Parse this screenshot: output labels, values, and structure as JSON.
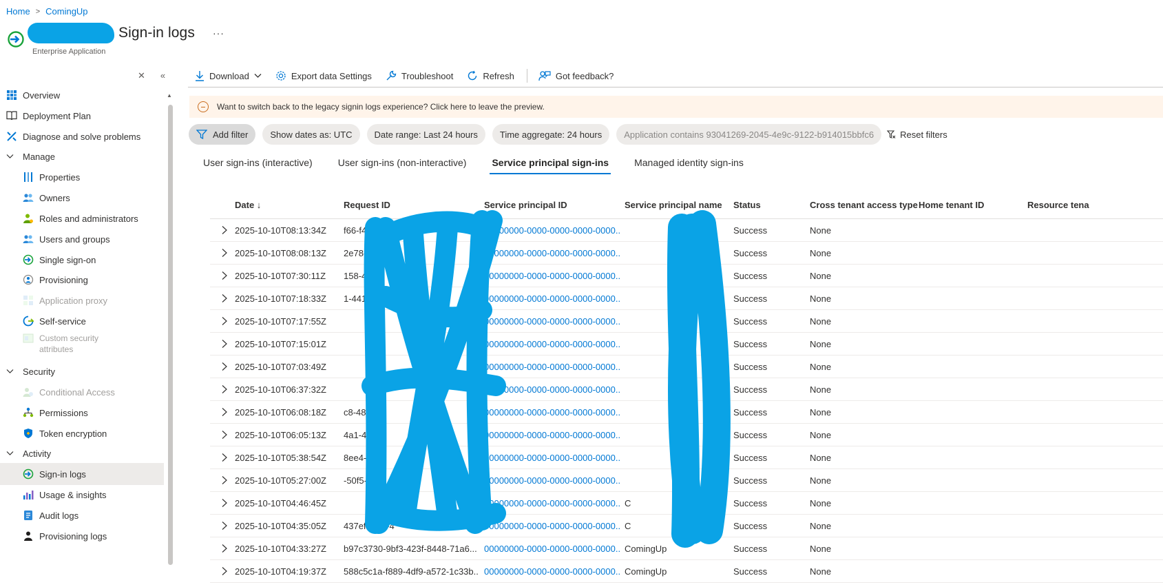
{
  "breadcrumb": [
    {
      "label": "Home"
    },
    {
      "label": "ComingUp"
    }
  ],
  "header": {
    "title": "Sign-in logs",
    "subtitle": "Enterprise Application",
    "more": "···"
  },
  "sidebar": {
    "items": [
      {
        "label": "Overview",
        "icon": "overview-icon",
        "level": 0,
        "type": "item"
      },
      {
        "label": "Deployment Plan",
        "icon": "book-icon",
        "level": 0,
        "type": "item"
      },
      {
        "label": "Diagnose and solve problems",
        "icon": "wrench-icon",
        "level": 0,
        "type": "item"
      },
      {
        "label": "Manage",
        "level": 0,
        "type": "group"
      },
      {
        "label": "Properties",
        "icon": "properties-icon",
        "level": 1,
        "type": "item"
      },
      {
        "label": "Owners",
        "icon": "owners-icon",
        "level": 1,
        "type": "item"
      },
      {
        "label": "Roles and administrators",
        "icon": "roles-icon",
        "level": 1,
        "type": "item"
      },
      {
        "label": "Users and groups",
        "icon": "users-icon",
        "level": 1,
        "type": "item"
      },
      {
        "label": "Single sign-on",
        "icon": "sso-icon",
        "level": 1,
        "type": "item"
      },
      {
        "label": "Provisioning",
        "icon": "provisioning-icon",
        "level": 1,
        "type": "item"
      },
      {
        "label": "Application proxy",
        "icon": "proxy-icon",
        "level": 1,
        "type": "item",
        "disabled": true
      },
      {
        "label": "Self-service",
        "icon": "self-service-icon",
        "level": 1,
        "type": "item"
      },
      {
        "label": "Custom security attributes",
        "icon": "custom-attributes-icon",
        "level": 1,
        "type": "item",
        "disabled": true,
        "twoline": true
      },
      {
        "label": "Security",
        "level": 0,
        "type": "group"
      },
      {
        "label": "Conditional Access",
        "icon": "conditional-access-icon",
        "level": 1,
        "type": "item",
        "disabled": true
      },
      {
        "label": "Permissions",
        "icon": "permissions-icon",
        "level": 1,
        "type": "item"
      },
      {
        "label": "Token encryption",
        "icon": "shield-icon",
        "level": 1,
        "type": "item"
      },
      {
        "label": "Activity",
        "level": 0,
        "type": "group"
      },
      {
        "label": "Sign-in logs",
        "icon": "sign-in-icon",
        "level": 1,
        "type": "item",
        "active": true
      },
      {
        "label": "Usage & insights",
        "icon": "insights-icon",
        "level": 1,
        "type": "item"
      },
      {
        "label": "Audit logs",
        "icon": "audit-icon",
        "level": 1,
        "type": "item"
      },
      {
        "label": "Provisioning logs",
        "icon": "person-icon",
        "level": 1,
        "type": "item"
      }
    ]
  },
  "toolbar": {
    "download": "Download",
    "export": "Export data Settings",
    "troubleshoot": "Troubleshoot",
    "refresh": "Refresh",
    "feedback": "Got feedback?"
  },
  "banner": {
    "text": "Want to switch back to the legacy signin logs experience? Click here to leave the preview."
  },
  "filters": {
    "add": "Add filter",
    "dates": "Show dates as: UTC",
    "range": "Date range: Last 24 hours",
    "aggregate": "Time aggregate: 24 hours",
    "application": "Application contains 93041269-2045-4e9c-9122-b914015bbfc6",
    "reset": "Reset filters"
  },
  "tabs": [
    {
      "label": "User sign-ins (interactive)"
    },
    {
      "label": "User sign-ins (non-interactive)"
    },
    {
      "label": "Service principal sign-ins",
      "active": true
    },
    {
      "label": "Managed identity sign-ins"
    }
  ],
  "table": {
    "columns": {
      "date": "Date ↓",
      "request_id": "Request ID",
      "sp_id": "Service principal ID",
      "sp_name": "Service principal name",
      "status": "Status",
      "cross_tenant": "Cross tenant access type",
      "home_tenant": "Home tenant ID",
      "resource_tenant": "Resource tena"
    },
    "rows": [
      {
        "date": "2025-10-10T08:13:34Z",
        "request_id": "f66-f450-4771-9250",
        "sp_id": "00000000-0000-0000-0000-0000...",
        "sp_name": "",
        "status": "Success",
        "cross_tenant": "None"
      },
      {
        "date": "2025-10-10T08:08:13Z",
        "request_id": "2e78-4c0",
        "sp_id": "00000000-0000-0000-0000-0000...",
        "sp_name": "",
        "status": "Success",
        "cross_tenant": "None"
      },
      {
        "date": "2025-10-10T07:30:11Z",
        "request_id": "158-4335",
        "sp_id": "00000000-0000-0000-0000-0000...",
        "sp_name": "",
        "status": "Success",
        "cross_tenant": "None"
      },
      {
        "date": "2025-10-10T07:18:33Z",
        "request_id": "1-441",
        "sp_id": "00000000-0000-0000-0000-0000...",
        "sp_name": "",
        "status": "Success",
        "cross_tenant": "None"
      },
      {
        "date": "2025-10-10T07:17:55Z",
        "request_id": "",
        "sp_id": "00000000-0000-0000-0000-0000...",
        "sp_name": "",
        "status": "Success",
        "cross_tenant": "None"
      },
      {
        "date": "2025-10-10T07:15:01Z",
        "request_id": "",
        "sp_id": "00000000-0000-0000-0000-0000...",
        "sp_name": "",
        "status": "Success",
        "cross_tenant": "None"
      },
      {
        "date": "2025-10-10T07:03:49Z",
        "request_id": "",
        "sp_id": "00000000-0000-0000-0000-0000...",
        "sp_name": "",
        "status": "Success",
        "cross_tenant": "None"
      },
      {
        "date": "2025-10-10T06:37:32Z",
        "request_id": "",
        "sp_id": "00000000-0000-0000-0000-0000...",
        "sp_name": "",
        "status": "Success",
        "cross_tenant": "None"
      },
      {
        "date": "2025-10-10T06:08:18Z",
        "request_id": "c8-48",
        "sp_id": "00000000-0000-0000-0000-0000...",
        "sp_name": "",
        "status": "Success",
        "cross_tenant": "None"
      },
      {
        "date": "2025-10-10T06:05:13Z",
        "request_id": "4a1-4db",
        "sp_id": "00000000-0000-0000-0000-0000...",
        "sp_name": "",
        "status": "Success",
        "cross_tenant": "None"
      },
      {
        "date": "2025-10-10T05:38:54Z",
        "request_id": "8ee4-479",
        "sp_id": "00000000-0000-0000-0000-0000...",
        "sp_name": "",
        "status": "Success",
        "cross_tenant": "None"
      },
      {
        "date": "2025-10-10T05:27:00Z",
        "request_id": "-50f5-4fb",
        "sp_id": "00000000-0000-0000-0000-0000...",
        "sp_name": "",
        "status": "Success",
        "cross_tenant": "None"
      },
      {
        "date": "2025-10-10T04:46:45Z",
        "request_id": "",
        "sp_id": "00000000-0000-0000-0000-0000...",
        "sp_name": "C",
        "status": "Success",
        "cross_tenant": "None"
      },
      {
        "date": "2025-10-10T04:35:05Z",
        "request_id": "437ef-3f09-4",
        "sp_id": "00000000-0000-0000-0000-0000...",
        "sp_name": "C",
        "status": "Success",
        "cross_tenant": "None"
      },
      {
        "date": "2025-10-10T04:33:27Z",
        "request_id": "b97c3730-9bf3-423f-8448-71a6...",
        "sp_id": "00000000-0000-0000-0000-0000...",
        "sp_name": "ComingUp",
        "status": "Success",
        "cross_tenant": "None"
      },
      {
        "date": "2025-10-10T04:19:37Z",
        "request_id": "588c5c1a-f889-4df9-a572-1c33b...",
        "sp_id": "00000000-0000-0000-0000-0000...",
        "sp_name": "ComingUp",
        "status": "Success",
        "cross_tenant": "None"
      }
    ]
  },
  "colors": {
    "accent": "#0078d4",
    "redaction": "#0aa3e6",
    "banner_bg": "#fff4ea",
    "active_nav": "#edebe9"
  }
}
